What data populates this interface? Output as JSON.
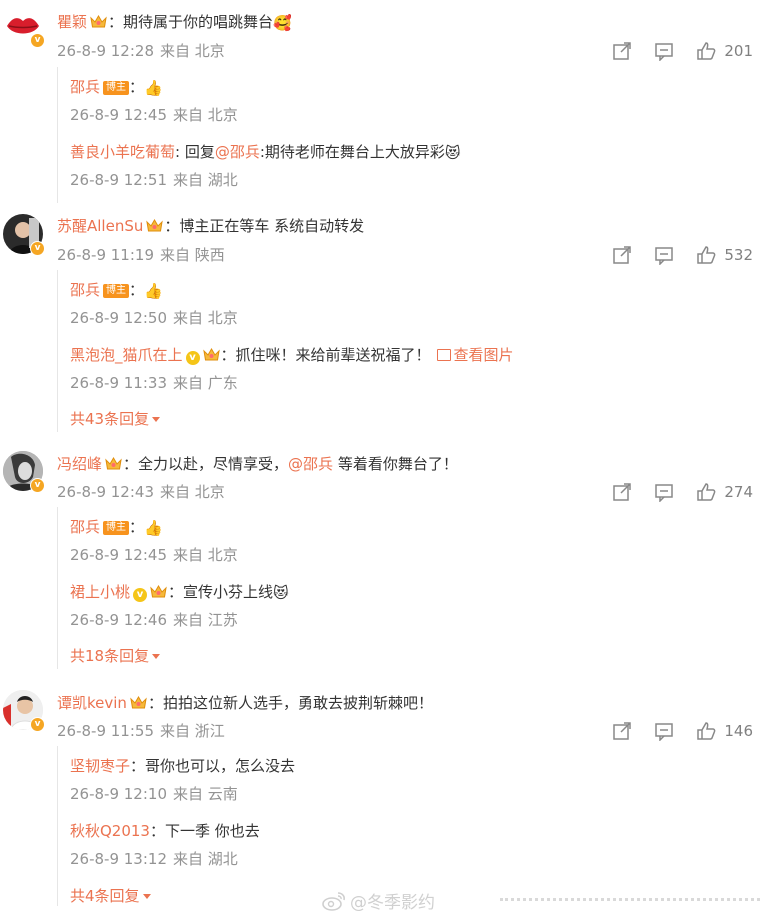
{
  "comments": [
    {
      "user": "瞿颖",
      "text": "：期待属于你的唱跳舞台",
      "emoji": "🥰",
      "time": "26-8-9 12:28",
      "location": "来自 北京",
      "likes": "201",
      "replies": [
        {
          "user": "邵兵",
          "badge": "博主",
          "text": "：",
          "emoji": "👍",
          "time": "26-8-9 12:45",
          "location": "来自 北京"
        },
        {
          "user": "善良小羊吃葡萄",
          "text": ": 回复",
          "mention": "@邵兵",
          "text2": ":期待老师在舞台上大放异彩",
          "emoji": "😻",
          "time": "26-8-9 12:51",
          "location": "来自 湖北"
        }
      ]
    },
    {
      "user": "苏醒AllenSu",
      "text": "：博主正在等车 系统自动转发",
      "time": "26-8-9 11:19",
      "location": "来自 陕西",
      "likes": "532",
      "replies": [
        {
          "user": "邵兵",
          "badge": "博主",
          "text": "：",
          "emoji": "👍",
          "time": "26-8-9 12:50",
          "location": "来自 北京"
        },
        {
          "user": "黑泡泡_猫爪在上",
          "text": "：抓住咪！来给前辈送祝福了！",
          "link": "查看图片",
          "time": "26-8-9 11:33",
          "location": "来自 广东"
        }
      ],
      "more": "共43条回复"
    },
    {
      "user": "冯绍峰",
      "text": "：全力以赴，尽情享受，",
      "mention": "@邵兵",
      "text2": " 等着看你舞台了！",
      "time": "26-8-9 12:43",
      "location": "来自 北京",
      "likes": "274",
      "replies": [
        {
          "user": "邵兵",
          "badge": "博主",
          "text": "：",
          "emoji": "👍",
          "time": "26-8-9 12:45",
          "location": "来自 北京"
        },
        {
          "user": "裙上小桃",
          "text": "：宣传小芬上线",
          "emoji": "😻",
          "time": "26-8-9 12:46",
          "location": "来自 江苏"
        }
      ],
      "more": "共18条回复"
    },
    {
      "user": "谭凯kevin",
      "text": "：拍拍这位新人选手，勇敢去披荆斩棘吧！",
      "time": "26-8-9 11:55",
      "location": "来自 浙江",
      "likes": "146",
      "replies": [
        {
          "user": "坚韧枣子",
          "text": "：哥你也可以，怎么没去",
          "time": "26-8-9 12:10",
          "location": "来自 云南"
        },
        {
          "user": "秋秋Q2013",
          "text": "：下一季 你也去",
          "time": "26-8-9 13:12",
          "location": "来自 湖北"
        }
      ],
      "more": "共4条回复"
    }
  ],
  "watermark": "@冬季影约",
  "colors": {
    "username": "#eb7350",
    "meta": "#939393",
    "badge": "#f7931e"
  }
}
